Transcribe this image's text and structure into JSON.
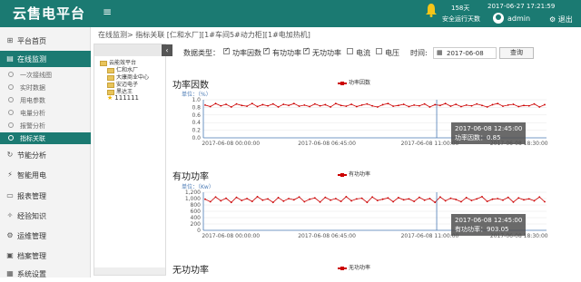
{
  "header": {
    "logo": "云售电平台",
    "menu_icon": "≡",
    "bell_icon": "bell-icon",
    "run_days_value": "158天",
    "run_days_label": "安全运行天数",
    "datetime": "2017-06-27 17:21:59",
    "user": "admin",
    "logout": "退出",
    "accent": "#1b7a72"
  },
  "sidebar": {
    "items": [
      {
        "icon": "⊞",
        "label": "平台首页"
      },
      {
        "icon": "▤",
        "label": "在线监测"
      },
      {
        "icon": "↻",
        "label": "节能分析"
      },
      {
        "icon": "⚡",
        "label": "智能用电"
      },
      {
        "icon": "▭",
        "label": "报表管理"
      },
      {
        "icon": "✧",
        "label": "经验知识"
      },
      {
        "icon": "⚙",
        "label": "运维管理"
      },
      {
        "icon": "▣",
        "label": "档案管理"
      },
      {
        "icon": "▦",
        "label": "系统设置"
      }
    ],
    "sub_items": [
      {
        "label": "一次接线图"
      },
      {
        "label": "实时数据"
      },
      {
        "label": "用电参数"
      },
      {
        "label": "电量分析"
      },
      {
        "label": "报警分析"
      },
      {
        "label": "指标关联"
      }
    ]
  },
  "breadcrumb": "在线监测> 指标关联 [仁和水厂][1#车间5#动力柜][1#电加热机]",
  "tree": {
    "collapse": "‹",
    "nodes": [
      {
        "label": "云能效平台",
        "type": "folder"
      },
      {
        "label": "仁和水厂",
        "type": "folder"
      },
      {
        "label": "大康商业中心",
        "type": "folder"
      },
      {
        "label": "安迈电子",
        "type": "folder"
      },
      {
        "label": "黑达王",
        "type": "folder"
      },
      {
        "label": "111111",
        "type": "star"
      }
    ]
  },
  "filter": {
    "label": "数据类型：",
    "options": [
      {
        "label": "功率因数",
        "checked": true
      },
      {
        "label": "有功功率",
        "checked": true
      },
      {
        "label": "无功功率",
        "checked": true
      },
      {
        "label": "电流",
        "checked": false
      },
      {
        "label": "电压",
        "checked": false
      }
    ],
    "time_label": "时间:",
    "date_value": "2017-06-08",
    "query_label": "查询"
  },
  "charts": [
    {
      "title": "功率因数",
      "legend": "功率因数",
      "unit": "单位：（%）",
      "tooltip_time": "2017-06-08 12:45:00",
      "tooltip_value": "功率因数：0.85"
    },
    {
      "title": "有功功率",
      "legend": "有功功率",
      "unit": "单位：（Kw）",
      "tooltip_time": "2017-06-08 12:45:00",
      "tooltip_value": "有功功率：903.05"
    },
    {
      "title": "无功功率",
      "legend": "无功功率"
    }
  ],
  "chart_data": [
    {
      "type": "line",
      "title": "功率因数",
      "ylabel": "单位：（%）",
      "x_ticks": [
        "2017-06-08 00:00:00",
        "2017-06-08 06:45:00",
        "2017-06-08 11:00:00",
        "2017-06-08 18:30:00"
      ],
      "y_ticks": [
        0,
        0.2,
        0.4,
        0.6,
        0.8,
        1.0
      ],
      "ylim": [
        0,
        1
      ],
      "series": [
        {
          "name": "功率因数",
          "color": "#cc0000",
          "values": [
            0.86,
            0.82,
            0.9,
            0.84,
            0.88,
            0.81,
            0.89,
            0.85,
            0.83,
            0.9,
            0.82,
            0.87,
            0.84,
            0.89,
            0.81,
            0.88,
            0.85,
            0.9,
            0.83,
            0.86,
            0.82,
            0.89,
            0.84,
            0.87,
            0.81,
            0.9,
            0.85,
            0.83,
            0.88,
            0.82,
            0.86,
            0.89,
            0.84,
            0.81,
            0.87,
            0.9,
            0.83,
            0.85,
            0.88,
            0.82,
            0.86,
            0.84,
            0.89,
            0.81,
            0.87,
            0.85,
            0.9,
            0.83,
            0.88,
            0.82,
            0.86,
            0.84,
            0.89,
            0.85,
            0.81,
            0.87,
            0.9,
            0.83,
            0.86,
            0.88,
            0.82,
            0.85,
            0.84,
            0.89,
            0.81,
            0.87
          ]
        }
      ],
      "tooltip": {
        "x": "2017-06-08 12:45:00",
        "value": 0.85
      }
    },
    {
      "type": "line",
      "title": "有功功率",
      "ylabel": "单位：（Kw）",
      "x_ticks": [
        "2017-06-08 00:00:00",
        "2017-06-08 06:45:00",
        "2017-06-08 11:00:00",
        "2017-06-08 18:30:00"
      ],
      "y_ticks": [
        0,
        200,
        400,
        600,
        800,
        1000,
        1200
      ],
      "ylim": [
        0,
        1200
      ],
      "series": [
        {
          "name": "有功功率",
          "color": "#cc0000",
          "values": [
            980,
            900,
            1050,
            930,
            1010,
            880,
            1040,
            940,
            1000,
            910,
            1060,
            950,
            990,
            880,
            1030,
            920,
            1000,
            960,
            1050,
            900,
            980,
            1020,
            890,
            1040,
            950,
            1000,
            910,
            1060,
            930,
            990,
            1010,
            880,
            1050,
            940,
            980,
            1020,
            900,
            1030,
            960,
            990,
            910,
            1040,
            950,
            1000,
            880,
            1050,
            930,
            1010,
            970,
            900,
            1030,
            940,
            990,
            1060,
            910,
            980,
            1000,
            950,
            1040,
            890,
            1020,
            960,
            990,
            930,
            1050,
            900
          ]
        }
      ],
      "tooltip": {
        "x": "2017-06-08 12:45:00",
        "value": 903.05
      }
    }
  ]
}
